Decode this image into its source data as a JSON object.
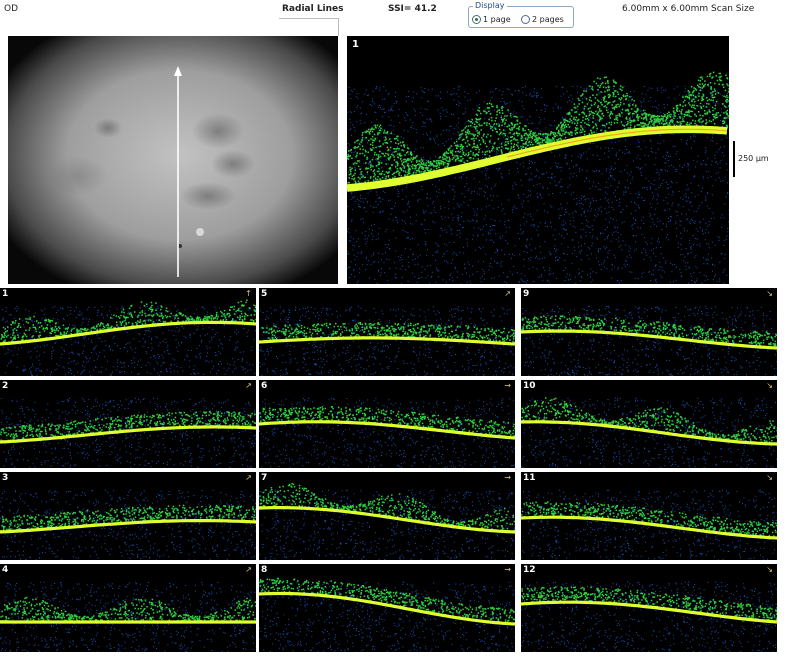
{
  "header": {
    "eye": "OD",
    "title": "Radial Lines",
    "ssi": "SSI= 41.2",
    "scan_size": "6.00mm x 6.00mm Scan Size",
    "display": {
      "legend": "Display",
      "options": [
        "1 page",
        "2 pages"
      ],
      "selected": "1 page"
    }
  },
  "main_scan": {
    "number": "1"
  },
  "scale": {
    "label": "250 µm"
  },
  "thumbnails": [
    {
      "number": "1",
      "direction": "↑",
      "column": 0,
      "row": 0
    },
    {
      "number": "2",
      "direction": "↗",
      "column": 0,
      "row": 1
    },
    {
      "number": "3",
      "direction": "↗",
      "column": 0,
      "row": 2
    },
    {
      "number": "4",
      "direction": "↗",
      "column": 0,
      "row": 3
    },
    {
      "number": "5",
      "direction": "↗",
      "column": 1,
      "row": 0
    },
    {
      "number": "6",
      "direction": "→",
      "column": 1,
      "row": 1
    },
    {
      "number": "7",
      "direction": "→",
      "column": 1,
      "row": 2
    },
    {
      "number": "8",
      "direction": "→",
      "column": 1,
      "row": 3
    },
    {
      "number": "9",
      "direction": "↘",
      "column": 2,
      "row": 0
    },
    {
      "number": "10",
      "direction": "↘",
      "column": 2,
      "row": 1
    },
    {
      "number": "11",
      "direction": "↘",
      "column": 2,
      "row": 2
    },
    {
      "number": "12",
      "direction": "↘",
      "column": 2,
      "row": 3
    }
  ],
  "colors": {
    "retina_band": "#e0ff30",
    "retina_glow": "#30d040",
    "noise": "#1a4fb8",
    "hot": "#ff8010",
    "arrow": "#d8c870"
  }
}
